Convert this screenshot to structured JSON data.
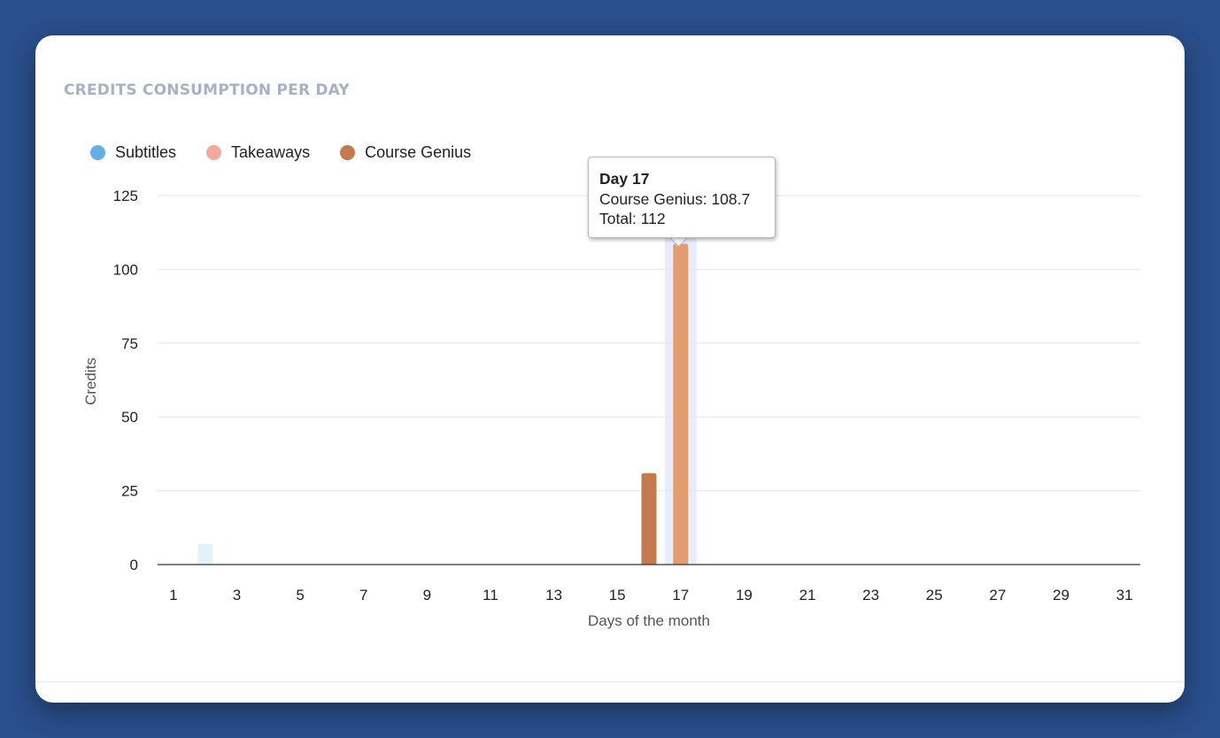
{
  "card": {
    "title": "CREDITS CONSUMPTION PER DAY"
  },
  "tooltip": {
    "title": "Day 17",
    "line1": "Course Genius: 108.7",
    "line2": "Total: 112"
  },
  "colors": {
    "page_background": "#294f8c",
    "card_background": "#ffffff",
    "subtitles": "#62b0e6",
    "takeaways": "#f3aa9d",
    "course_genius": "#c57a4c",
    "course_genius_hover": "#e39c6c",
    "hover_band": "#e8ecff"
  },
  "chart_data": {
    "type": "bar",
    "stacked": true,
    "title": "",
    "xlabel": "Days of the month",
    "ylabel": "Credits",
    "ylim": [
      0,
      125
    ],
    "yticks": [
      0,
      25,
      50,
      75,
      100,
      125
    ],
    "x": [
      1,
      2,
      3,
      4,
      5,
      6,
      7,
      8,
      9,
      10,
      11,
      12,
      13,
      14,
      15,
      16,
      17,
      18,
      19,
      20,
      21,
      22,
      23,
      24,
      25,
      26,
      27,
      28,
      29,
      30,
      31
    ],
    "xticks": [
      1,
      3,
      5,
      7,
      9,
      11,
      13,
      15,
      17,
      19,
      21,
      23,
      25,
      27,
      29,
      31
    ],
    "grid": true,
    "legend_position": "top-left",
    "hovered_day": 17,
    "series": [
      {
        "name": "Subtitles",
        "color": "#62b0e6",
        "values": [
          0,
          7,
          0,
          0,
          0,
          0,
          0,
          0,
          0,
          0,
          0,
          0,
          0,
          0,
          0,
          0,
          0,
          0,
          0,
          0,
          0,
          0,
          0,
          0,
          0,
          0,
          0,
          0,
          0,
          0,
          0
        ]
      },
      {
        "name": "Takeaways",
        "color": "#f3aa9d",
        "values": [
          0,
          0,
          0,
          0,
          0,
          0,
          0,
          0,
          0,
          0,
          0,
          0,
          0,
          0,
          0,
          0,
          0,
          0,
          0,
          0,
          0,
          0,
          0,
          0,
          0,
          0,
          0,
          0,
          0,
          0,
          0
        ]
      },
      {
        "name": "Course Genius",
        "color": "#c57a4c",
        "values": [
          0,
          0,
          0,
          0,
          0,
          0,
          0,
          0,
          0,
          0,
          0,
          0,
          0,
          0,
          0,
          31,
          108.7,
          0,
          0,
          0,
          0,
          0,
          0,
          0,
          0,
          0,
          0,
          0,
          0,
          0,
          0
        ]
      }
    ]
  }
}
